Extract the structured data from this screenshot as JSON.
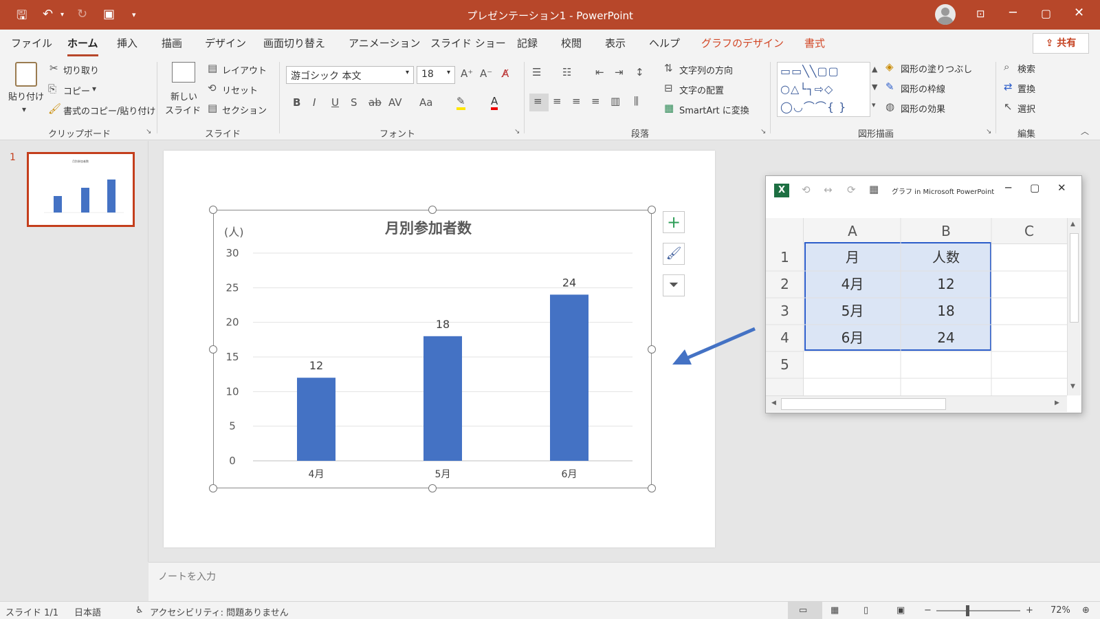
{
  "window": {
    "title": "プレゼンテーション1 - PowerPoint"
  },
  "colors": {
    "accent": "#b7472a",
    "bar": "#4472c4",
    "selection": "#2b5cc9"
  },
  "quick_access": {
    "icons": [
      "save-icon",
      "undo-icon",
      "redo-icon",
      "start-from-beginning-icon",
      "customize-icon"
    ]
  },
  "tabs": [
    {
      "label": "ファイル"
    },
    {
      "label": "ホーム"
    },
    {
      "label": "挿入"
    },
    {
      "label": "描画"
    },
    {
      "label": "デザイン"
    },
    {
      "label": "画面切り替え"
    },
    {
      "label": "アニメーション"
    },
    {
      "label": "スライド ショー"
    },
    {
      "label": "記録"
    },
    {
      "label": "校閲"
    },
    {
      "label": "表示"
    },
    {
      "label": "ヘルプ"
    },
    {
      "label": "グラフのデザイン"
    },
    {
      "label": "書式"
    }
  ],
  "share_label": "共有",
  "ribbon": {
    "clipboard": {
      "paste": "貼り付け",
      "cut": "切り取り",
      "copy": "コピー",
      "format_painter": "書式のコピー/貼り付け",
      "label": "クリップボード"
    },
    "slides": {
      "new_slide_1": "新しい",
      "new_slide_2": "スライド",
      "layout": "レイアウト",
      "reset": "リセット",
      "section": "セクション",
      "label": "スライド"
    },
    "font": {
      "name": "游ゴシック 本文",
      "size": "18",
      "label": "フォント"
    },
    "paragraph": {
      "text_direction": "文字列の方向",
      "align_text": "文字の配置",
      "smartart": "SmartArt に変換",
      "label": "段落"
    },
    "drawing": {
      "fill": "図形の塗りつぶし",
      "outline": "図形の枠線",
      "effects": "図形の効果",
      "label": "図形描画"
    },
    "editing": {
      "find": "検索",
      "replace": "置換",
      "select": "選択",
      "label": "編集"
    }
  },
  "slide_panel": {
    "number": "1"
  },
  "chart_data": {
    "type": "bar",
    "title": "月別参加者数",
    "ylabel": "(人)",
    "categories": [
      "4月",
      "5月",
      "6月"
    ],
    "values": [
      12,
      18,
      24
    ],
    "ylim": [
      0,
      30
    ],
    "yticks": [
      "30",
      "25",
      "20",
      "15",
      "10",
      "5",
      "0"
    ],
    "data_labels": [
      "12",
      "18",
      "24"
    ],
    "grid": true,
    "legend": "none"
  },
  "excel": {
    "title": "グラフ in Microsoft PowerPoint",
    "columns": [
      "A",
      "B",
      "C"
    ],
    "row_numbers": [
      "1",
      "2",
      "3",
      "4",
      "5"
    ],
    "rows": [
      [
        "月",
        "人数"
      ],
      [
        "4月",
        "12"
      ],
      [
        "5月",
        "18"
      ],
      [
        "6月",
        "24"
      ]
    ]
  },
  "notes_placeholder": "ノートを入力",
  "status": {
    "slide": "スライド 1/1",
    "language": "日本語",
    "accessibility": "アクセシビリティ: 問題ありません",
    "zoom": "72%"
  }
}
